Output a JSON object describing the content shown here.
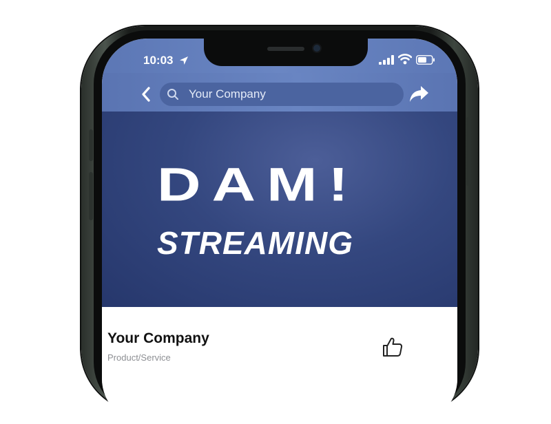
{
  "status_bar": {
    "time": "10:03",
    "icons": [
      "location-arrow-icon",
      "signal-icon",
      "wifi-icon",
      "battery-icon"
    ]
  },
  "nav": {
    "back_icon": "chevron-left-icon",
    "search_icon": "search-icon",
    "search_value": "Your Company",
    "share_icon": "share-arrow-icon"
  },
  "cover": {
    "title": "DAM!",
    "subtitle": "STREAMING"
  },
  "page": {
    "name": "Your Company",
    "category": "Product/Service",
    "like_icon": "thumbs-up-icon"
  },
  "colors": {
    "header_blue": "#6580be",
    "search_field": "#4b64a0",
    "cover_dark": "#26376c"
  }
}
